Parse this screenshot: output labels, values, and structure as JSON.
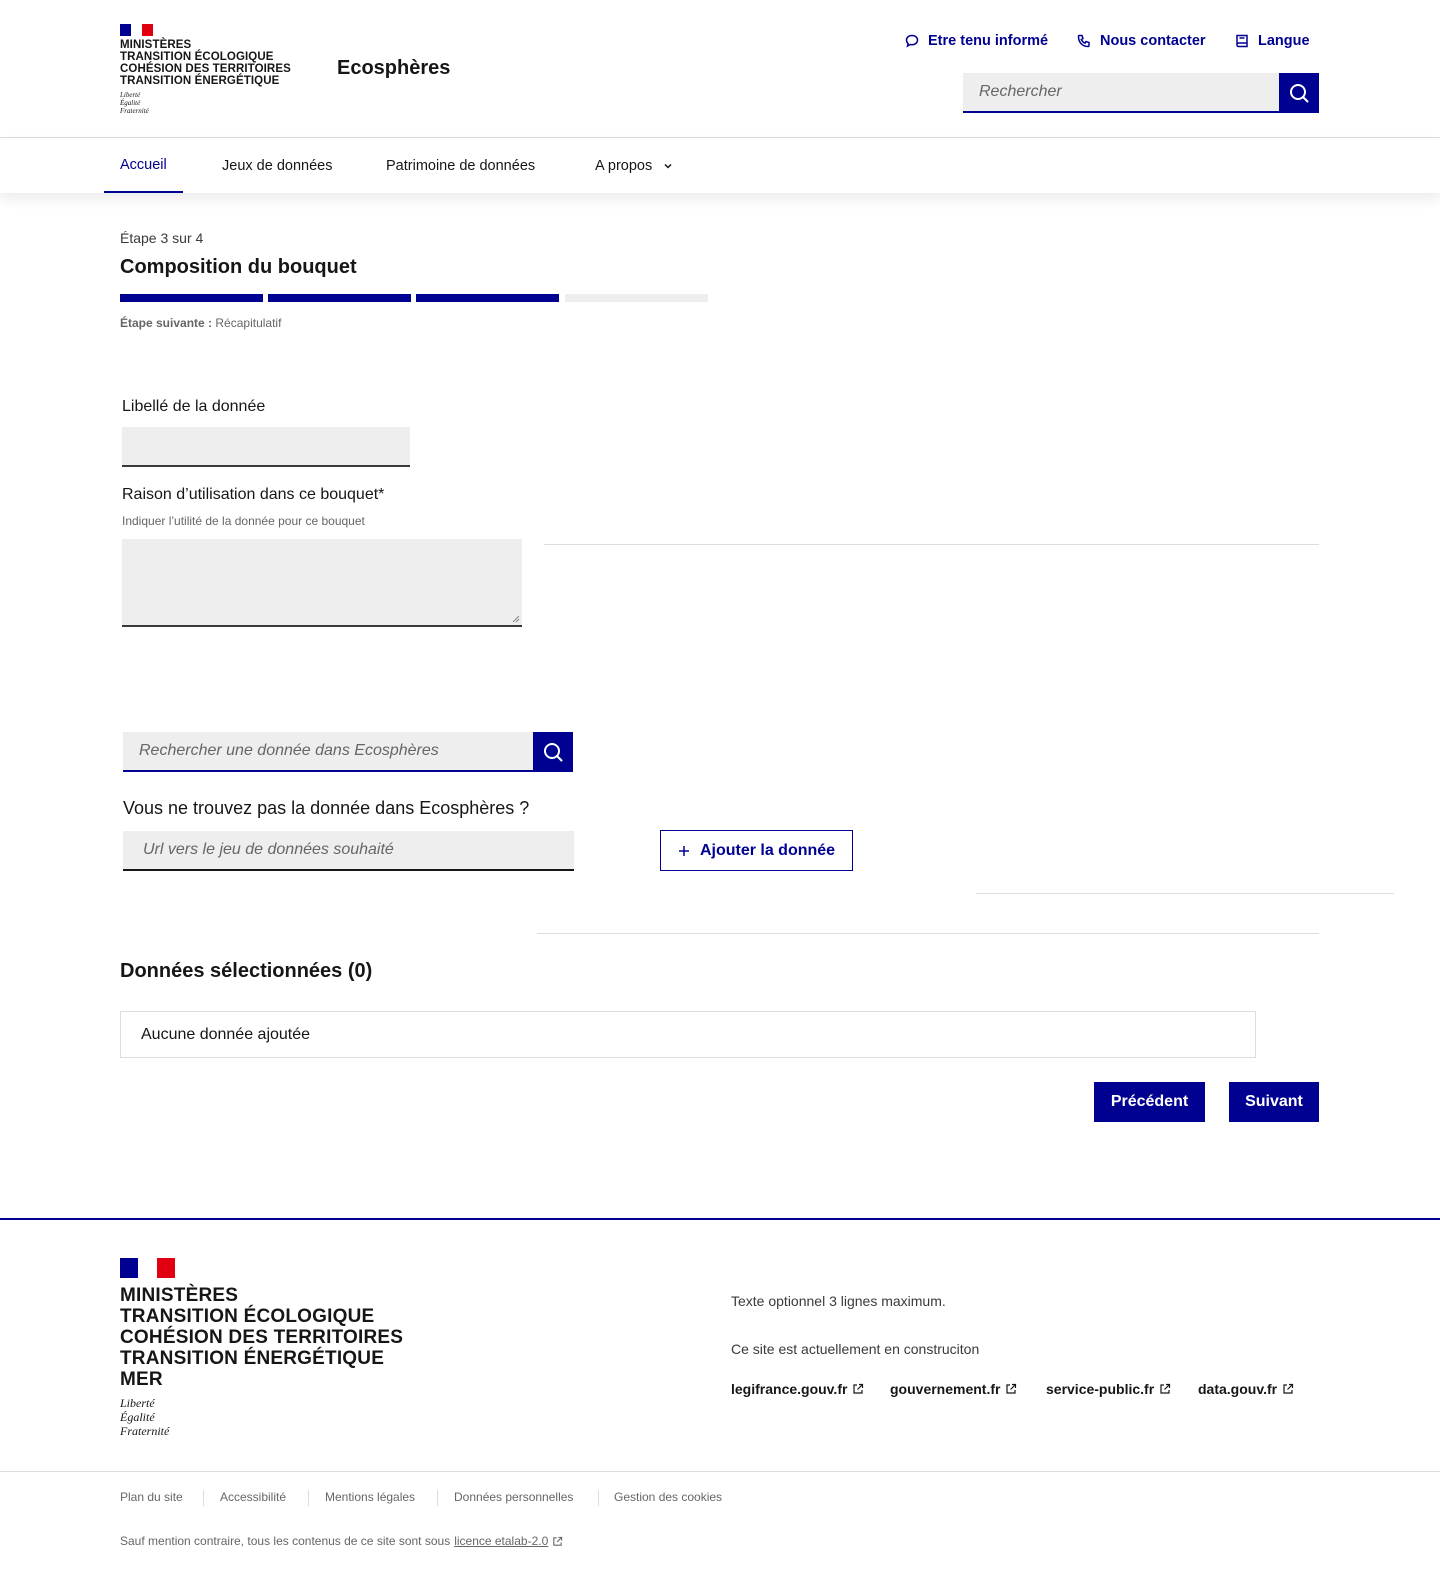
{
  "header": {
    "ministry_lines": [
      "Ministères",
      "Transition écologique",
      "Cohésion des territoires",
      "Transition énergétique"
    ],
    "motto": [
      "Liberté",
      "Égalité",
      "Fraternité"
    ],
    "site_title": "Ecosphères",
    "quick_links": [
      {
        "label": "Etre tenu informé",
        "icon": "chat-bubble-icon"
      },
      {
        "label": "Nous contacter",
        "icon": "phone-icon"
      },
      {
        "label": "Langue",
        "icon": "book-icon"
      }
    ],
    "search": {
      "placeholder": "Rechercher",
      "icon": "search-icon"
    }
  },
  "nav": {
    "items": [
      "Accueil",
      "Jeux de données",
      "Patrimoine de données",
      "A propos"
    ],
    "active": "Accueil"
  },
  "stepper": {
    "step_text": "Étape 3 sur 4",
    "title": "Composition du bouquet",
    "steps_total": 4,
    "steps_done": 3,
    "next_label": "Étape suivante :",
    "next_value": "Récapitulatif"
  },
  "form": {
    "label_field": {
      "label": "Libellé de la donnée",
      "value": ""
    },
    "reason_field": {
      "label": "Raison d’utilisation dans ce bouquet*",
      "hint": "Indiquer l’utilité de la donnée pour ce bouquet",
      "value": ""
    },
    "data_search": {
      "placeholder": "Rechercher une donnée dans Ecosphères"
    },
    "not_found_title": "Vous ne trouvez pas la donnée dans Ecosphères ?",
    "url_field": {
      "placeholder": "Url vers le jeu de données souhaité"
    },
    "add_button": "Ajouter la donnée"
  },
  "selected": {
    "title": "Données sélectionnées (0)",
    "empty_text": "Aucune donnée ajoutée"
  },
  "actions": {
    "previous": "Précédent",
    "next": "Suivant"
  },
  "footer": {
    "ministry_lines": [
      "Ministères",
      "Transition écologique",
      "Cohésion des territoires",
      "Transition énergétique",
      "Mer"
    ],
    "motto": [
      "Liberté",
      "Égalité",
      "Fraternité"
    ],
    "optional_text": "Texte optionnel 3 lignes maximum.",
    "construction_text": "Ce site est actuellement en construciton",
    "external_links": [
      "legifrance.gouv.fr",
      "gouvernement.fr",
      "service-public.fr",
      "data.gouv.fr"
    ],
    "bottom_links": [
      "Plan du site",
      "Accessibilité",
      "Mentions légales",
      "Données personnelles",
      "Gestion des cookies"
    ],
    "license_prefix": "Sauf mention contraire, tous les contenus de ce site sont sous",
    "license_link": "licence etalab-2.0"
  },
  "colors": {
    "primary": "#000091",
    "grey_bg": "#eeeeee",
    "border": "#dddddd",
    "flag_red": "#e1000f"
  }
}
